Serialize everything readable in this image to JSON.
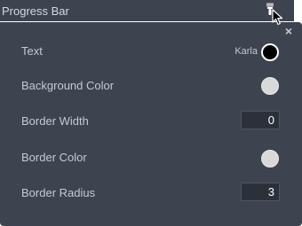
{
  "header": {
    "title": "Progress Bar"
  },
  "panel": {
    "close_glyph": "×",
    "rows": [
      {
        "label": "Text",
        "font": "Karla",
        "swatch_color": "#000000"
      },
      {
        "label": "Background Color",
        "swatch_color": "#d9d9d9"
      },
      {
        "label": "Border Width",
        "value": "0"
      },
      {
        "label": "Border Color",
        "swatch_color": "#d9d9d9"
      },
      {
        "label": "Border Radius",
        "value": "3"
      }
    ]
  },
  "icons": {
    "header_tool": "paint-brush-icon",
    "pointer": "mouse-cursor-icon",
    "close": "close-icon"
  },
  "colors": {
    "panel_bg": "#3d434f",
    "field_bg": "#2b303a",
    "label_text": "#c6c9d0"
  }
}
